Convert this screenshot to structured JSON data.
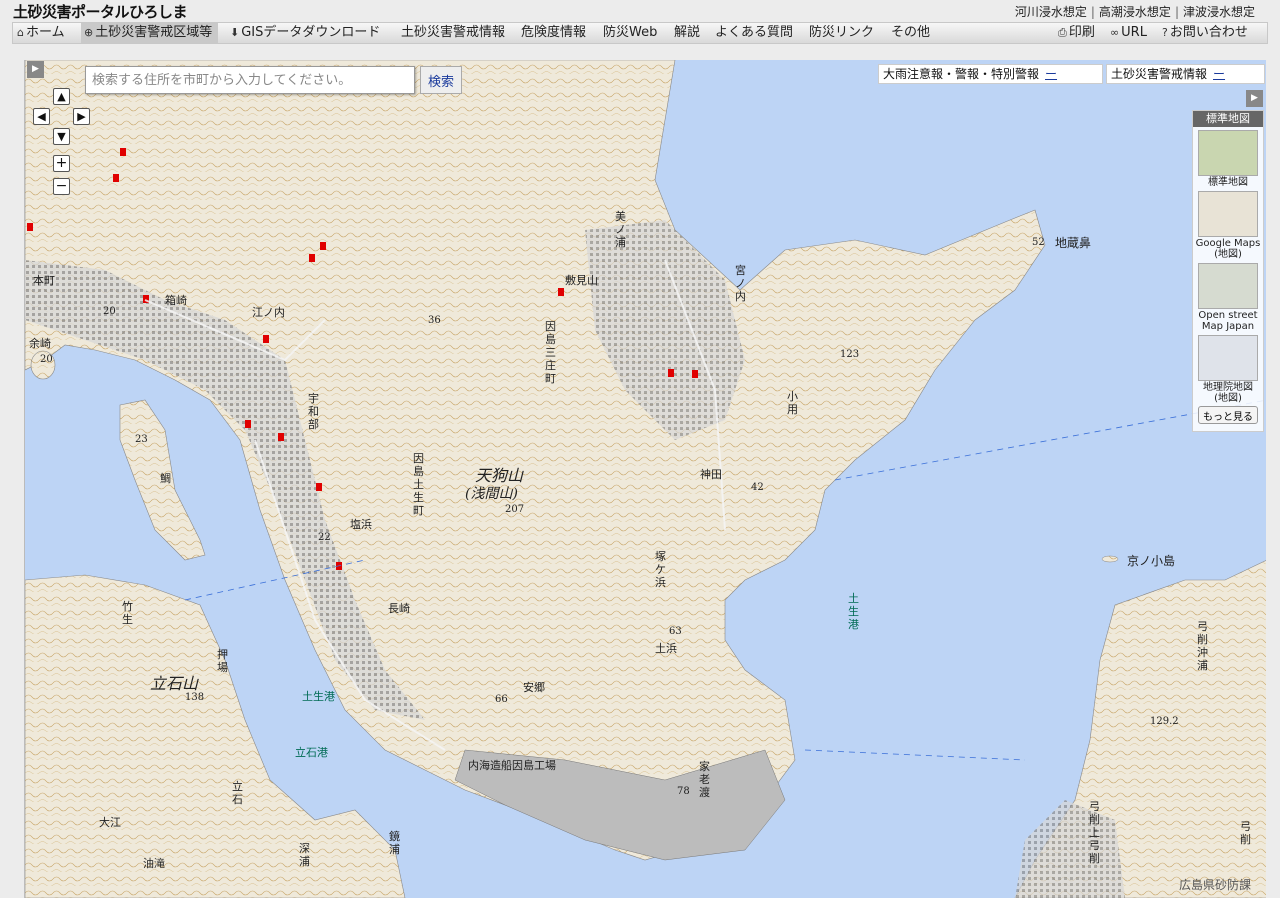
{
  "header": {
    "site_title": "土砂災害ポータルひろしま",
    "top_links": [
      "河川浸水想定",
      "高潮浸水想定",
      "津波浸水想定"
    ]
  },
  "nav": {
    "left_items": [
      {
        "label": "ホーム",
        "icon": "home-icon"
      },
      {
        "label": "土砂災害警戒区域等",
        "icon": "globe-icon",
        "active": true
      },
      {
        "label": "GISデータダウンロード",
        "icon": "download-icon"
      },
      {
        "label": "土砂災害警戒情報"
      },
      {
        "label": "危険度情報"
      },
      {
        "label": "防災Web"
      },
      {
        "label": "解説"
      },
      {
        "label": "よくある質問"
      },
      {
        "label": "防災リンク"
      },
      {
        "label": "その他"
      }
    ],
    "right_items": [
      {
        "label": "印刷",
        "icon": "print-icon"
      },
      {
        "label": "URL",
        "icon": "link-icon"
      },
      {
        "label": "お問い合わせ",
        "icon": "help-icon"
      }
    ]
  },
  "map": {
    "search": {
      "placeholder": "検索する住所を市町から入力してください。",
      "button_label": "検索"
    },
    "alerts": [
      {
        "label": "大雨注意報・警報・特別警報",
        "status": "ー"
      },
      {
        "label": "土砂災害警戒情報",
        "status": "ー"
      }
    ],
    "basemap_panel": {
      "header": "標準地図",
      "options": [
        {
          "label": "標準地図",
          "color": "#c9d6b0"
        },
        {
          "label": "Google Maps\n(地図)",
          "color": "#e8e3d6"
        },
        {
          "label": "Open street\nMap Japan",
          "color": "#d6dbd0"
        },
        {
          "label": "地理院地図\n(地図)",
          "color": "#dfe3ea"
        }
      ],
      "more_label": "もっと見る"
    },
    "place_labels": [
      {
        "text": "天狗山",
        "size": 16
      },
      {
        "text": "(浅間山)",
        "size": 14
      },
      {
        "text": "立石山",
        "size": 16
      },
      {
        "text": "京ノ小島",
        "size": 12
      },
      {
        "text": "地蔵鼻",
        "size": 12
      },
      {
        "text": "土生港",
        "size": 11
      },
      {
        "text": "立石港",
        "size": 11
      },
      {
        "text": "土生港",
        "size": 11
      },
      {
        "text": "内海造船因島工場",
        "size": 11
      },
      {
        "text": "箱崎",
        "size": 11
      },
      {
        "text": "宇和部",
        "size": 11
      },
      {
        "text": "塩浜",
        "size": 11
      },
      {
        "text": "長崎",
        "size": 11
      },
      {
        "text": "安郷",
        "size": 11
      },
      {
        "text": "家老渡",
        "size": 11
      },
      {
        "text": "大江",
        "size": 11
      },
      {
        "text": "深浦",
        "size": 11
      },
      {
        "text": "鏡浦",
        "size": 11
      },
      {
        "text": "神田",
        "size": 11
      },
      {
        "text": "宮ノ内",
        "size": 11
      },
      {
        "text": "小用",
        "size": 11
      },
      {
        "text": "弓削沖浦",
        "size": 11
      },
      {
        "text": "弓削上弓削",
        "size": 11
      },
      {
        "text": "弓削",
        "size": 11
      },
      {
        "text": "本町",
        "size": 11
      },
      {
        "text": "江ノ内",
        "size": 11
      },
      {
        "text": "鯛",
        "size": 11
      },
      {
        "text": "敷見山",
        "size": 11
      },
      {
        "text": "因島土生町",
        "size": 11
      },
      {
        "text": "因島三庄町",
        "size": 11
      },
      {
        "text": "押場",
        "size": 11
      },
      {
        "text": "竹生",
        "size": 11
      },
      {
        "text": "立石",
        "size": 11
      },
      {
        "text": "油滝",
        "size": 11
      },
      {
        "text": "塚ケ浜",
        "size": 11
      },
      {
        "text": "土浜",
        "size": 11
      },
      {
        "text": "美ノ浦",
        "size": 11
      },
      {
        "text": "余崎",
        "size": 11
      }
    ],
    "elevations": [
      "207",
      "138",
      "129.2",
      "36",
      "52",
      "123",
      "42",
      "63",
      "66",
      "78",
      "23",
      "20",
      "22",
      "20"
    ],
    "attribution": "広島県砂防課"
  }
}
